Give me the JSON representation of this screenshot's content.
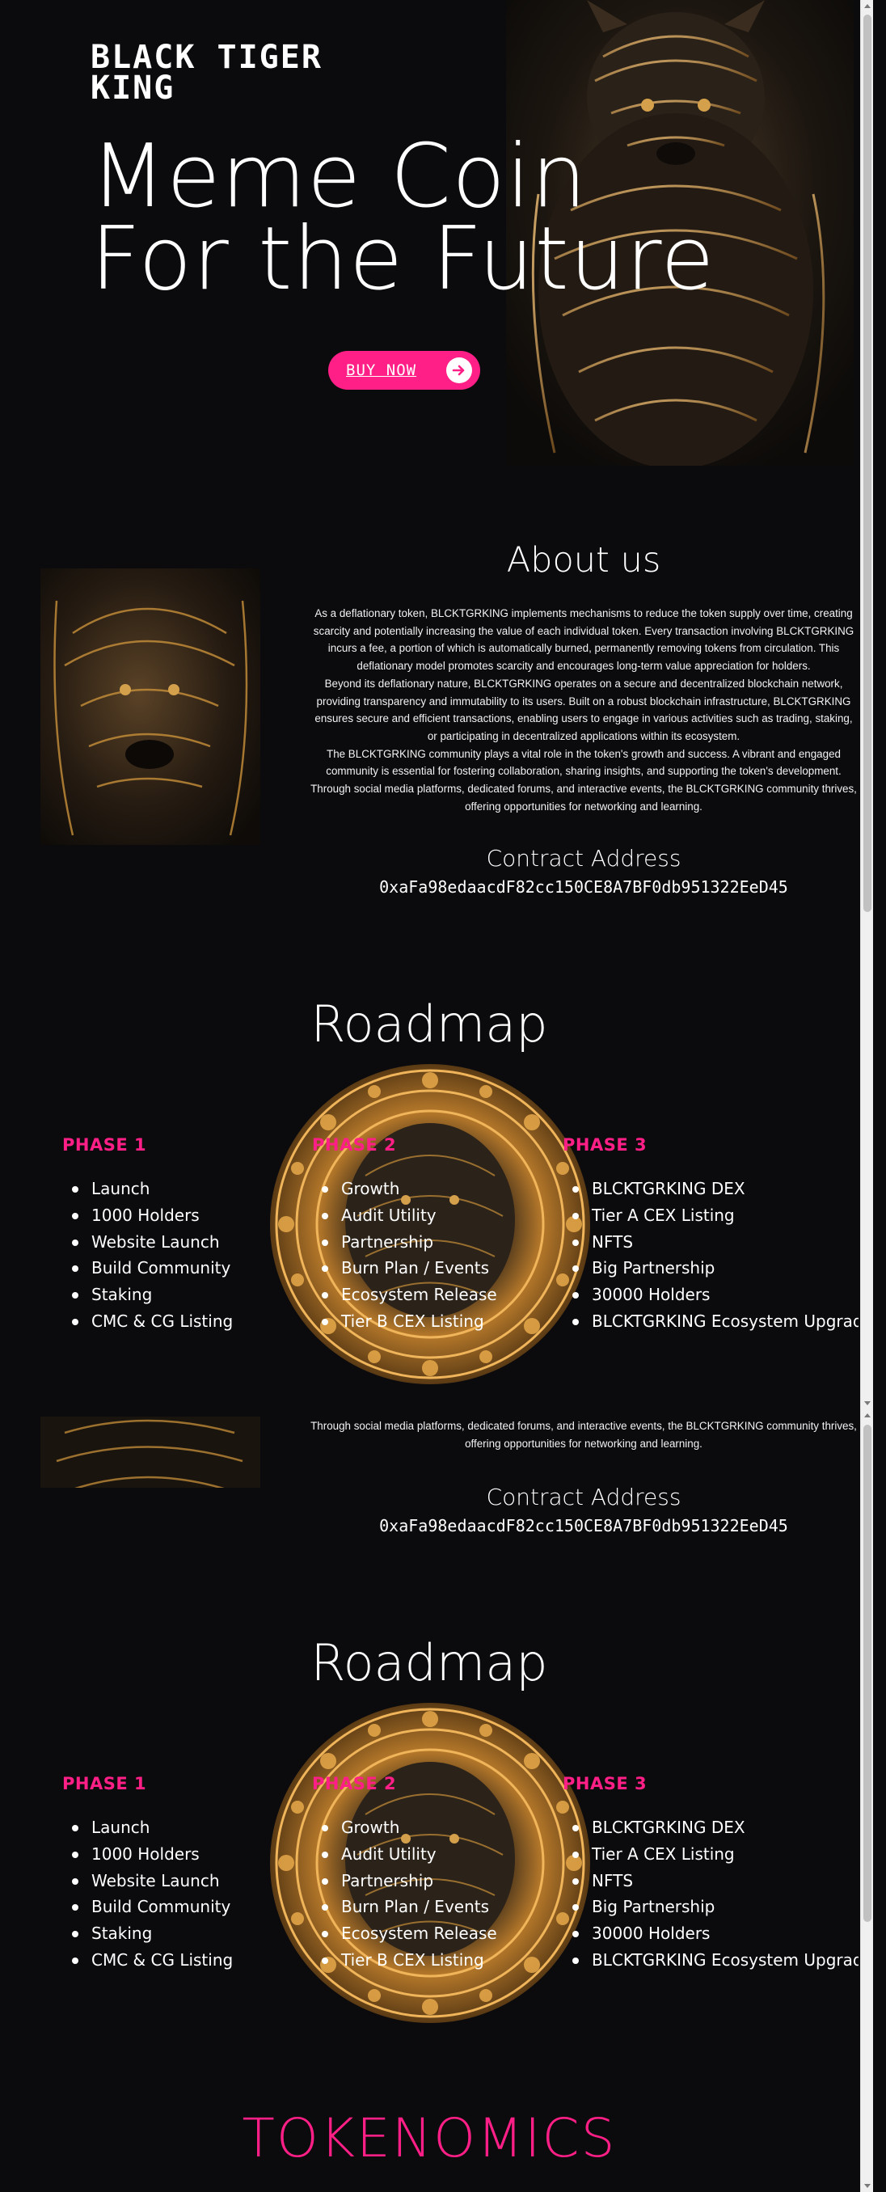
{
  "hero": {
    "logo": "BLACK TIGER KING",
    "title_line1": "Meme Coin",
    "title_line2": "For the Future",
    "buy_label": "BUY NOW"
  },
  "about": {
    "title": "About us",
    "paragraphs": [
      "As a deflationary token, BLCKTGRKING implements mechanisms to reduce the token supply over time, creating scarcity and potentially increasing the value of each individual token. Every transaction involving BLCKTGRKING incurs a fee, a portion of which is automatically burned, permanently removing tokens from circulation. This deflationary model promotes scarcity and encourages long-term value appreciation for holders.",
      "Beyond its deflationary nature, BLCKTGRKING operates on a secure and decentralized blockchain network, providing transparency and immutability to its users. Built on a robust blockchain infrastructure, BLCKTGRKING ensures secure and efficient transactions, enabling users to engage in various activities such as trading, staking, or participating in decentralized applications within its ecosystem.",
      "The BLCKTGRKING community plays a vital role in the token's growth and success. A vibrant and engaged community is essential for fostering collaboration, sharing insights, and supporting the token's development. Through social media platforms, dedicated forums, and interactive events, the BLCKTGRKING community thrives, offering opportunities for networking and learning."
    ],
    "partial_tail": "Through social media platforms, dedicated forums, and interactive events, the BLCKTGRKING community thrives, offering opportunities for networking and learning.",
    "contract_title": "Contract Address",
    "contract_address": "0xaFa98edaacdF82cc150CE8A7BF0db951322EeD45"
  },
  "roadmap": {
    "title": "Roadmap",
    "phases": [
      {
        "title": "PHASE 1",
        "items": [
          "Launch",
          "1000 Holders",
          "Website Launch",
          "Build Community",
          "Staking",
          "CMC & CG Listing"
        ]
      },
      {
        "title": "PHASE 2",
        "items": [
          "Growth",
          "Audit Utility",
          "Partnership",
          "Burn Plan / Events",
          "Ecosystem Release",
          "Tier B CEX Listing"
        ]
      },
      {
        "title": "PHASE 3",
        "items": [
          "BLCKTGRKING DEX",
          "Tier A CEX Listing",
          "NFTS",
          "Big Partnership",
          "30000 Holders",
          "BLCKTGRKING Ecosystem Upgrade"
        ]
      }
    ]
  },
  "tokenomics": {
    "title": "TOKENOMICS"
  },
  "colors": {
    "accent": "#ff1f86",
    "background": "#0b0b0e",
    "gold": "#c8903a"
  }
}
